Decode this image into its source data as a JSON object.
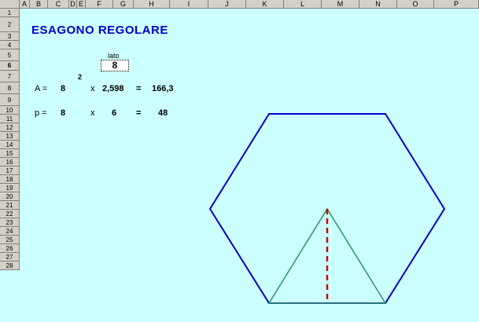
{
  "columns": [
    "A",
    "B",
    "C",
    "D",
    "E",
    "F",
    "G",
    "H",
    "I",
    "J",
    "K",
    "L",
    "M",
    "N",
    "O",
    "P"
  ],
  "rows": [
    "1",
    "2",
    "3",
    "4",
    "5",
    "6",
    "7",
    "8",
    "9",
    "10",
    "11",
    "12",
    "13",
    "14",
    "15",
    "16",
    "17",
    "18",
    "19",
    "20",
    "21",
    "22",
    "23",
    "24",
    "25",
    "26",
    "27",
    "28"
  ],
  "active_row": "6",
  "title": "ESAGONO REGOLARE",
  "input": {
    "label": "lato",
    "value": "8"
  },
  "area_row": {
    "label": "A =",
    "base": "8",
    "exponent": "2",
    "times": "x",
    "factor": "2,598",
    "equals": "=",
    "result": "166,3"
  },
  "perimeter_row": {
    "label": "p =",
    "base": "8",
    "times": "x",
    "factor": "6",
    "equals": "=",
    "result": "48"
  },
  "colors": {
    "background": "#ccffff",
    "hexagon": "#0000cc",
    "triangle": "#339966",
    "apothem": "#cc0000",
    "title": "#0000cc"
  }
}
